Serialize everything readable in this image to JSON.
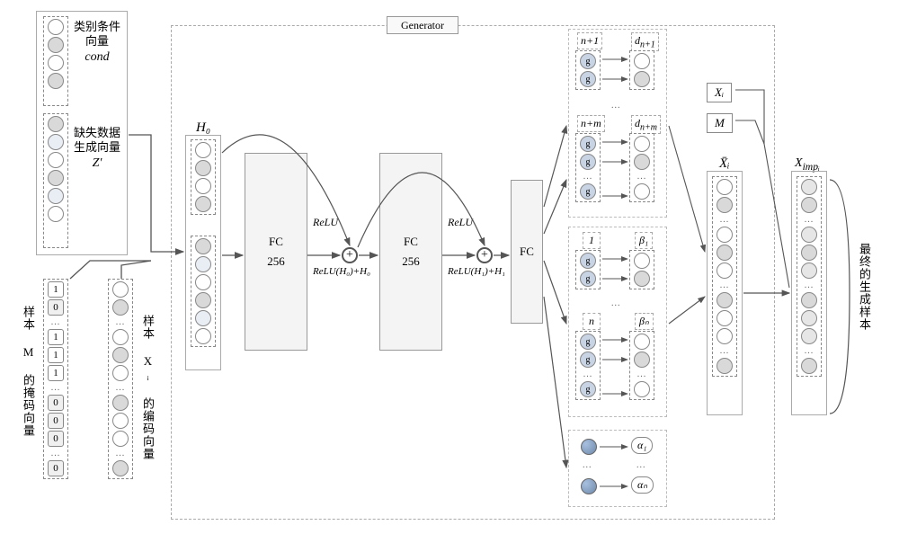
{
  "labels": {
    "cond_title": "类别条件向量",
    "cond_symbol": "cond",
    "z_title": "缺失数据生成向量",
    "z_symbol": "Z'",
    "mask_title": "样本 M 的掩码向量",
    "enc_title": "样本 Xᵢ 的编码向量",
    "h0": "H₀",
    "fc": "FC",
    "fc256": "256",
    "relu": "ReLU",
    "relu_h0": "ReLU(H₀)+H₀",
    "relu_h1": "ReLU(H₁)+H₁",
    "gen": "Generator",
    "head1": "n+1",
    "head1b": "d_{n+1}",
    "head2": "n+m",
    "head2b": "d_{n+m}",
    "one": "1",
    "beta1": "β₁",
    "n": "n",
    "betan": "βₙ",
    "g": "g",
    "alpha1": "α₁",
    "alphan": "αₙ",
    "xi": "Xᵢ",
    "m": "M",
    "xbar": "X̄ᵢ",
    "ximp": "X_{impᵢ}",
    "final": "最终的生成样本",
    "mask_values": [
      "1",
      "0",
      "1",
      "1",
      "1",
      "0",
      "0",
      "0",
      "0"
    ],
    "dots": "..."
  },
  "colors": {
    "c_empty": "#ffffff",
    "c_grey": "#d9d9d9",
    "c_light": "#e9eef5",
    "c_mask": "#f0f0f0",
    "c_blue": "#6f8aab"
  }
}
